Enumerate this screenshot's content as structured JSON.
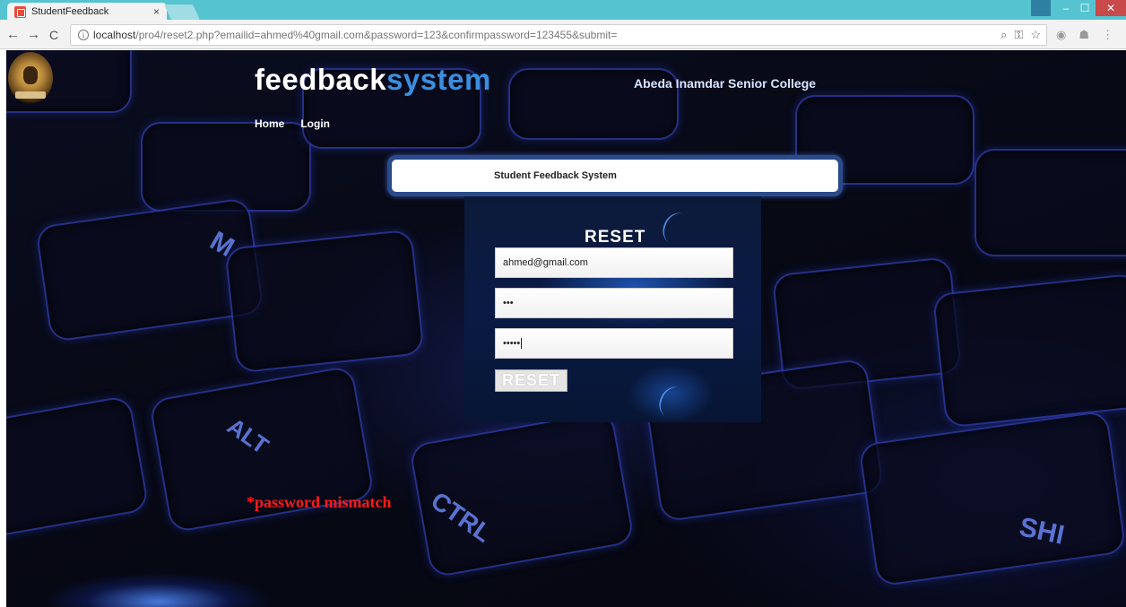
{
  "browser": {
    "tab_title": "StudentFeedback",
    "tab_close": "×",
    "window_controls": {
      "minimize": "–",
      "maximize": "☐",
      "close": "✕"
    },
    "nav": {
      "back": "←",
      "forward": "→",
      "reload": "C"
    },
    "info_icon": "i",
    "url_host": "localhost",
    "url_path": "/pro4/reset2.php?emailid=ahmed%40gmail.com&password=123&confirmpassword=123455&submit=",
    "icons": [
      "zoom-icon",
      "key-icon",
      "star-icon",
      "extension-icon",
      "profile-icon",
      "menu-icon"
    ]
  },
  "header": {
    "brand_part1": "feedback",
    "brand_part2": "system",
    "college": "Abeda Inamdar Senior College",
    "nav": [
      "Home",
      "Login"
    ]
  },
  "banner": {
    "text": "Student Feedback System"
  },
  "form": {
    "title": "RESET",
    "email_value": "ahmed@gmail.com",
    "password_value": "•••",
    "confirm_value": "•••••",
    "button_label": "RESET"
  },
  "message": {
    "error": "*password mismatch"
  },
  "background": {
    "key_labels": [
      "M",
      "ALT",
      "CTRL",
      "SHI"
    ]
  },
  "colors": {
    "chrome_titlebar": "#55c4d0",
    "brand_accent": "#3a8fdf",
    "error": "#ff1a1a",
    "close_button": "#c94a4a"
  }
}
